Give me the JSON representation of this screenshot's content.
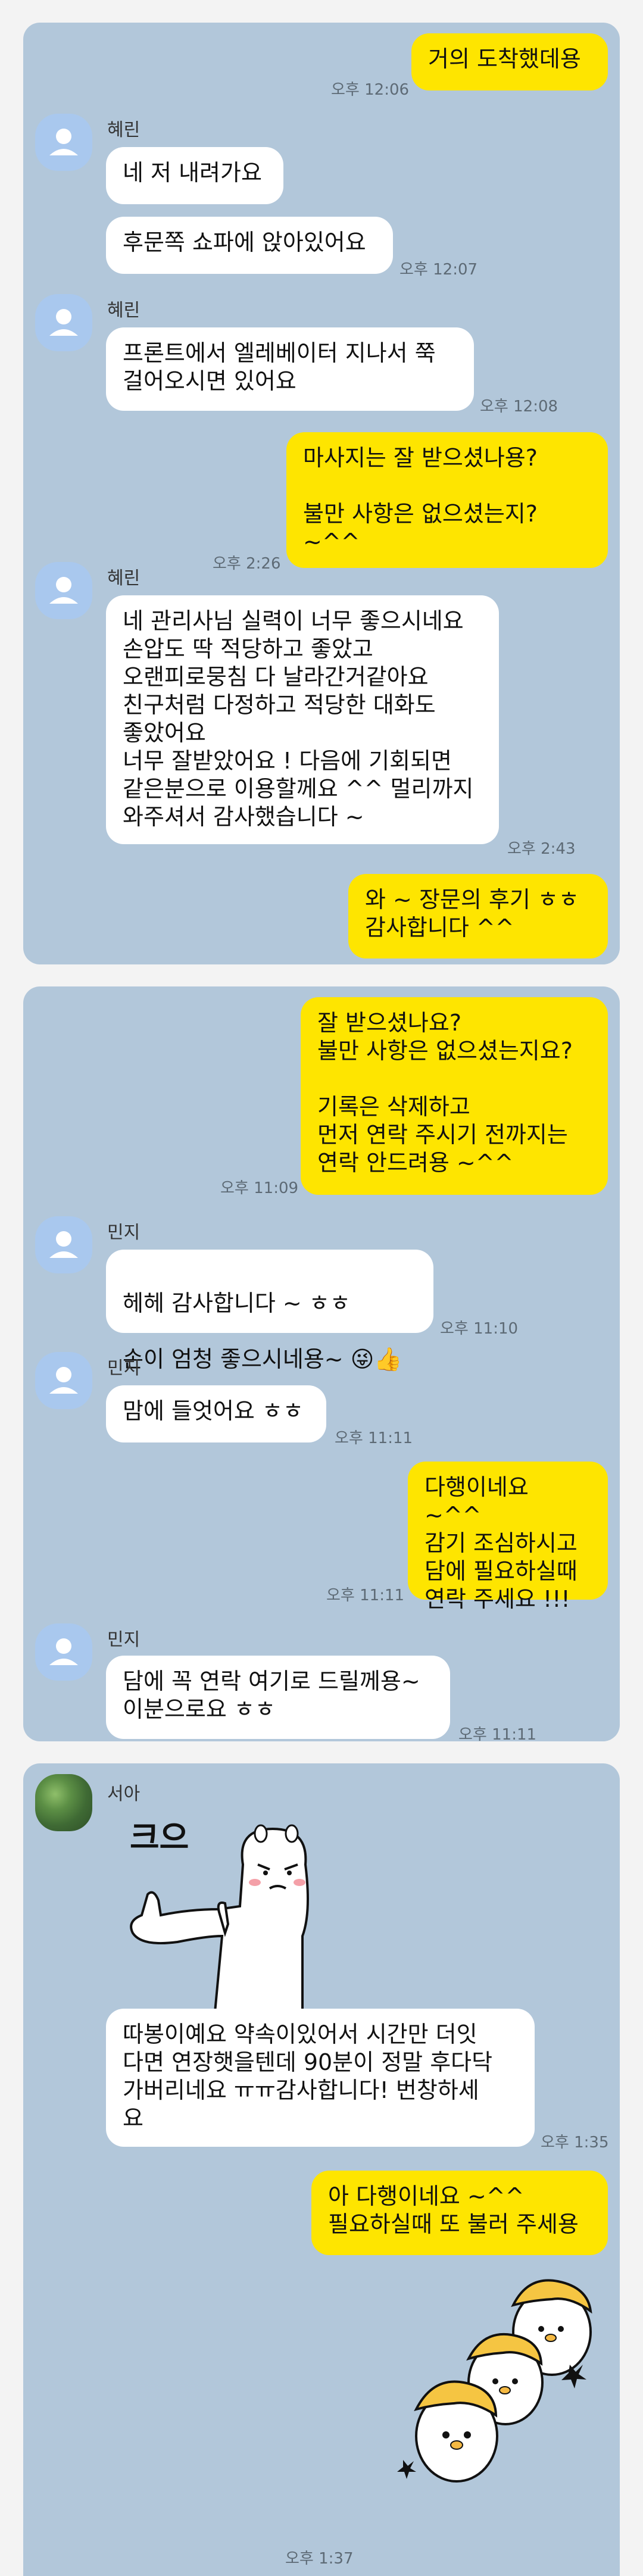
{
  "panel1": {
    "m1": {
      "text": "거의 도착했데용",
      "time": "오후 12:06"
    },
    "s1": {
      "name": "혜린"
    },
    "m2": {
      "text": "네 저 내려가요"
    },
    "m3": {
      "text": "후문쪽 쇼파에 앉아있어요",
      "time": "오후 12:07"
    },
    "s2": {
      "name": "혜린"
    },
    "m4": {
      "text": "프론트에서 엘레베이터 지나서 쭉\n걸어오시면 있어요",
      "time": "오후 12:08"
    },
    "m5": {
      "text": "마사지는 잘 받으셨나용?\n\n불만 사항은 없으셨는지? ~^^",
      "time": "오후 2:26"
    },
    "s3": {
      "name": "혜린"
    },
    "m6": {
      "text": "네 관리사님 실력이 너무 좋으시네요\n손압도 딱 적당하고 좋았고\n오랜피로뭉침 다 날라간거같아요\n친구처럼 다정하고 적당한 대화도\n좋았어요\n너무 잘받았어요 ! 다음에 기회되면\n같은분으로 이용할께요 ^^ 멀리까지\n와주셔서 감사했습니다 ~",
      "time": "오후 2:43"
    },
    "m7": {
      "text": "와 ~ 장문의 후기 ㅎㅎ\n감사합니다 ^^"
    }
  },
  "panel2": {
    "m1": {
      "text": "잘 받으셨나요?\n불만 사항은 없으셨는지요?\n\n기록은 삭제하고\n먼저 연락 주시기 전까지는\n연락 안드려용 ~^^",
      "time": "오후 11:09"
    },
    "s1": {
      "name": "민지"
    },
    "m2": {
      "line1": "헤헤 감사합니다 ~ ㅎㅎ",
      "line2": "손이 엄청 좋으시네용~ ",
      "emoji": "😜👍",
      "time": "오후 11:10"
    },
    "s2": {
      "name": "민지"
    },
    "m3": {
      "text": "맘에 들엇어요 ㅎㅎ",
      "time": "오후 11:11"
    },
    "m4": {
      "text": "다행이네요 ~^^\n감기 조심하시고\n담에 필요하실때\n연락 주세요 !!!",
      "time": "오후 11:11"
    },
    "s3": {
      "name": "민지"
    },
    "m5": {
      "text": "담에 꼭 연락 여기로 드릴께용~\n이분으로요 ㅎㅎ",
      "time": "오후 11:11"
    }
  },
  "panel3": {
    "s1": {
      "name": "서아"
    },
    "sticker_text": "크으",
    "m1": {
      "text": "따봉이예요 약속이있어서 시간만 더잇\n다면 연장햇을텐데 90분이 정말 후다닥\n가버리네요 ㅠㅠ감사합니다! 번창하세\n요",
      "time": "오후 1:35"
    },
    "m2": {
      "text": "아 다행이네요 ~^^\n필요하실때 또 불러 주세용",
      "time": "오후 1:37"
    }
  }
}
